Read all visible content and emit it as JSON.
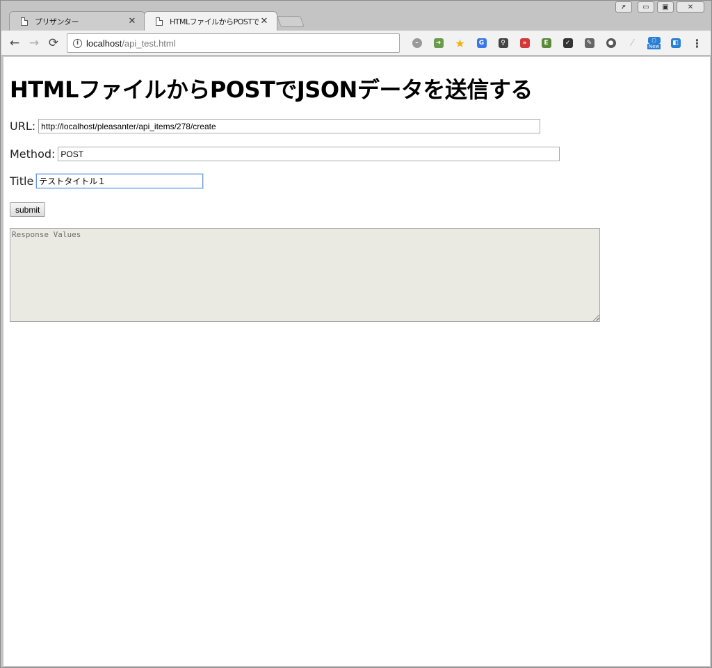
{
  "browser": {
    "tabs": [
      {
        "title": "プリザンター",
        "active": false
      },
      {
        "title": "HTMLファイルからPOSTでJS",
        "active": true
      }
    ],
    "address": {
      "host": "localhost",
      "path": "/api_test.html"
    },
    "window_controls": {
      "user": "ዖ",
      "minimize": "▭",
      "maximize": "▣",
      "close": "✕"
    },
    "nav": {
      "back": "←",
      "forward": "→",
      "reload": "⟳"
    },
    "extensions": [
      "block-icon",
      "rss-icon",
      "bookmark-star-icon",
      "translate-icon",
      "keep-icon",
      "readlater-icon",
      "evernote-icon",
      "pocket-icon",
      "paint-icon",
      "ghostery-icon",
      "lighthouse-icon",
      "new-badge-icon",
      "tag-icon",
      "menu-icon"
    ],
    "new_badge": "New"
  },
  "page": {
    "title": "HTMLファイルからPOSTでJSONデータを送信する",
    "form": {
      "url_label": "URL:",
      "url_value": "http://localhost/pleasanter/api_items/278/create",
      "method_label": "Method:",
      "method_value": "POST",
      "title_label": "Title",
      "title_value": "テストタイトル１",
      "submit_label": "submit",
      "response_placeholder": "Response Values"
    }
  }
}
